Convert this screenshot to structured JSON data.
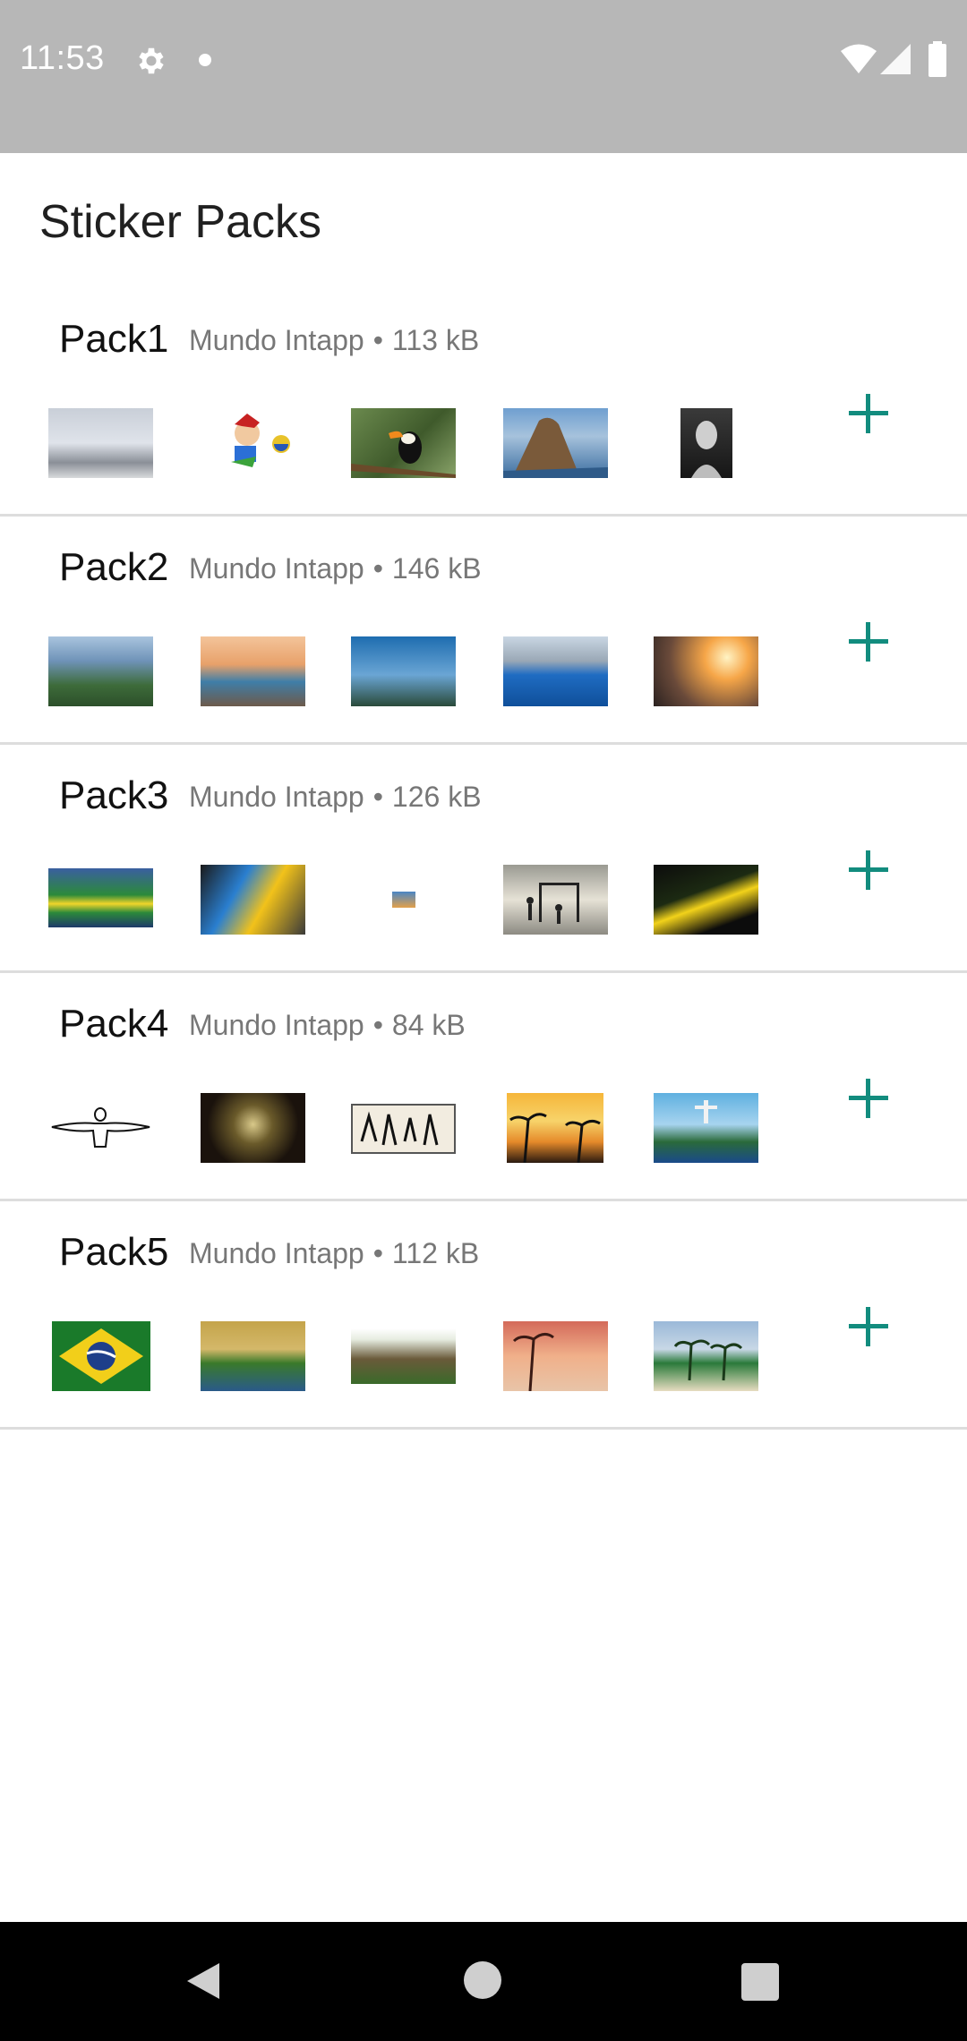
{
  "status_bar": {
    "time": "11:53",
    "icons": [
      "gear-icon",
      "notification-dot-icon",
      "wifi-icon",
      "signal-icon",
      "battery-icon"
    ]
  },
  "page": {
    "title": "Sticker Packs"
  },
  "colors": {
    "accent": "#128c7e",
    "status_bar": "#b7b7b7",
    "divider": "#dddddd"
  },
  "packs": [
    {
      "name": "Pack1",
      "publisher": "Mundo Intapp",
      "separator": "•",
      "size": "113 kB"
    },
    {
      "name": "Pack2",
      "publisher": "Mundo Intapp",
      "separator": "•",
      "size": "146 kB"
    },
    {
      "name": "Pack3",
      "publisher": "Mundo Intapp",
      "separator": "•",
      "size": "126 kB"
    },
    {
      "name": "Pack4",
      "publisher": "Mundo Intapp",
      "separator": "•",
      "size": "84 kB"
    },
    {
      "name": "Pack5",
      "publisher": "Mundo Intapp",
      "separator": "•",
      "size": "112 kB"
    }
  ],
  "nav_bar": {
    "icons": [
      "back-icon",
      "home-icon",
      "recents-icon"
    ]
  }
}
